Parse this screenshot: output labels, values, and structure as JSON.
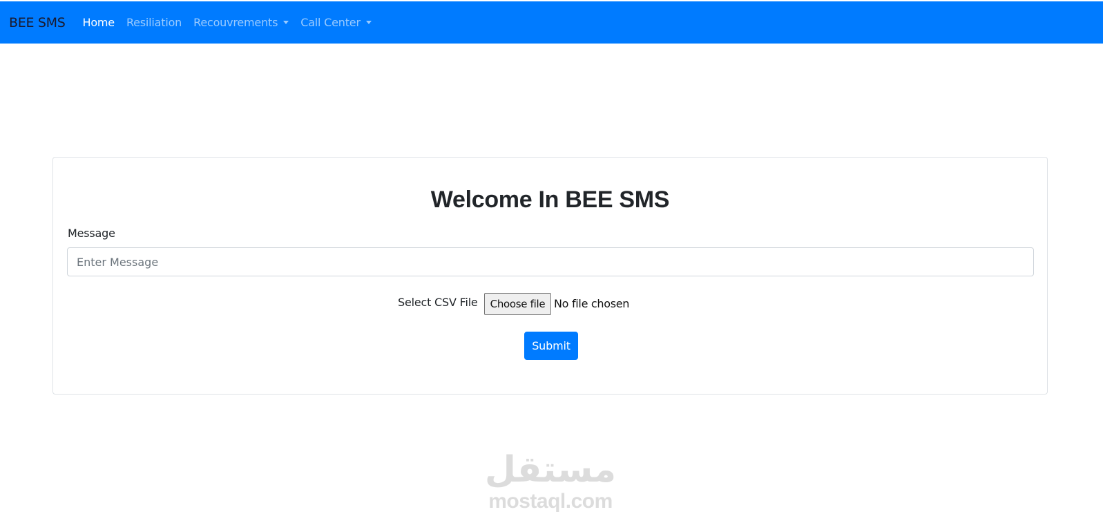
{
  "navbar": {
    "brand": "BEE SMS",
    "items": [
      {
        "label": "Home",
        "active": true,
        "dropdown": false
      },
      {
        "label": "Resiliation",
        "active": false,
        "dropdown": false
      },
      {
        "label": "Recouvrements",
        "active": false,
        "dropdown": true
      },
      {
        "label": "Call Center",
        "active": false,
        "dropdown": true
      }
    ],
    "color": "#007bff"
  },
  "form": {
    "title": "Welcome In BEE SMS",
    "message_label": "Message",
    "message_placeholder": "Enter Message",
    "message_value": "",
    "file_label": "Select CSV File",
    "file_button": "Choose file",
    "file_status": "No file chosen",
    "submit_label": "Submit"
  },
  "watermark": {
    "arabic": "مستقل",
    "latin": "mostaql.com"
  }
}
